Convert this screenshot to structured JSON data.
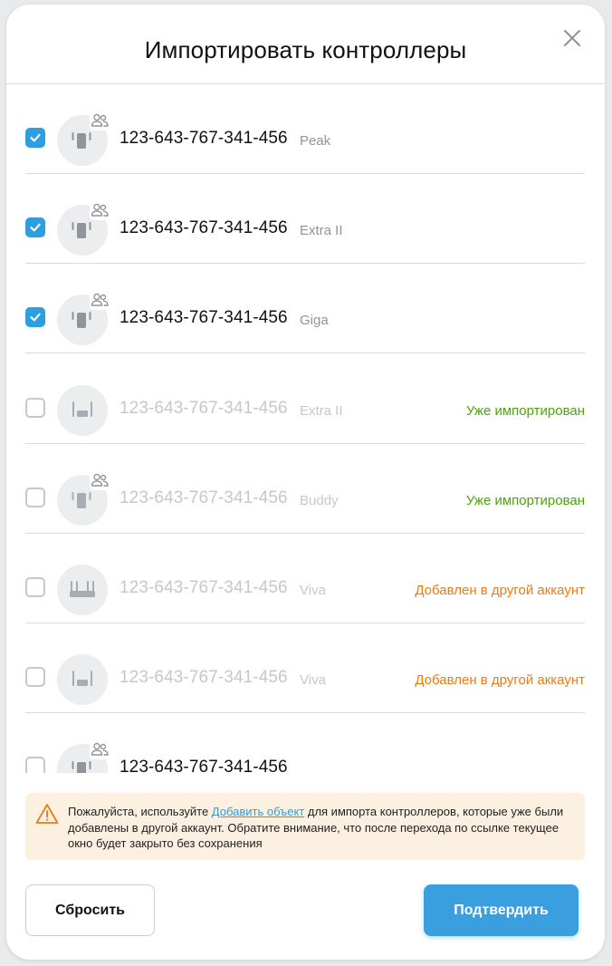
{
  "dialog": {
    "title": "Импортировать контроллеры",
    "close_icon": "close-icon"
  },
  "rows": [
    {
      "checked": true,
      "serial": "123-643-767-341-456",
      "model": "Peak",
      "status": "",
      "status_color": "",
      "device_icon": "repeater-icon",
      "shared": true,
      "disabled": false
    },
    {
      "checked": true,
      "serial": "123-643-767-341-456",
      "model": "Extra II",
      "status": "",
      "status_color": "",
      "device_icon": "repeater-icon",
      "shared": true,
      "disabled": false
    },
    {
      "checked": true,
      "serial": "123-643-767-341-456",
      "model": "Giga",
      "status": "",
      "status_color": "",
      "device_icon": "repeater-icon",
      "shared": true,
      "disabled": false
    },
    {
      "checked": false,
      "serial": "123-643-767-341-456",
      "model": "Extra II",
      "status": "Уже импортирован",
      "status_color": "#4ca30d",
      "device_icon": "repeater-icon",
      "shared": false,
      "disabled": true
    },
    {
      "checked": false,
      "serial": "123-643-767-341-456",
      "model": "Buddy",
      "status": "Уже импортирован",
      "status_color": "#4ca30d",
      "device_icon": "repeater-icon",
      "shared": true,
      "disabled": true
    },
    {
      "checked": false,
      "serial": "123-643-767-341-456",
      "model": "Viva",
      "status": "Добавлен в другой аккаунт",
      "status_color": "#f07a16",
      "device_icon": "router-icon",
      "shared": false,
      "disabled": true
    },
    {
      "checked": false,
      "serial": "123-643-767-341-456",
      "model": "Viva",
      "status": "Добавлен в другой аккаунт",
      "status_color": "#f07a16",
      "device_icon": "repeater-icon",
      "shared": false,
      "disabled": true
    },
    {
      "checked": false,
      "serial": "123-643-767-341-456",
      "model": "",
      "status": "",
      "status_color": "",
      "device_icon": "repeater-icon",
      "shared": true,
      "disabled": false
    }
  ],
  "notice": {
    "icon": "warning-icon",
    "text_before": "Пожалуйста, используйте ",
    "link": "Добавить объект",
    "text_after": " для импорта контроллеров, которые уже были добавлены в другой аккаунт. Обратите внимание, что после перехода по ссылке текущее окно будет закрыто без сохранения"
  },
  "buttons": {
    "reset": "Сбросить",
    "confirm": "Подтвердить"
  },
  "colors": {
    "accent": "#2d9ee0",
    "confirm_button": "#3a9fdf",
    "status_imported": "#4ca30d",
    "status_other_account": "#f07a16",
    "notice_background": "#fcf1e1"
  }
}
